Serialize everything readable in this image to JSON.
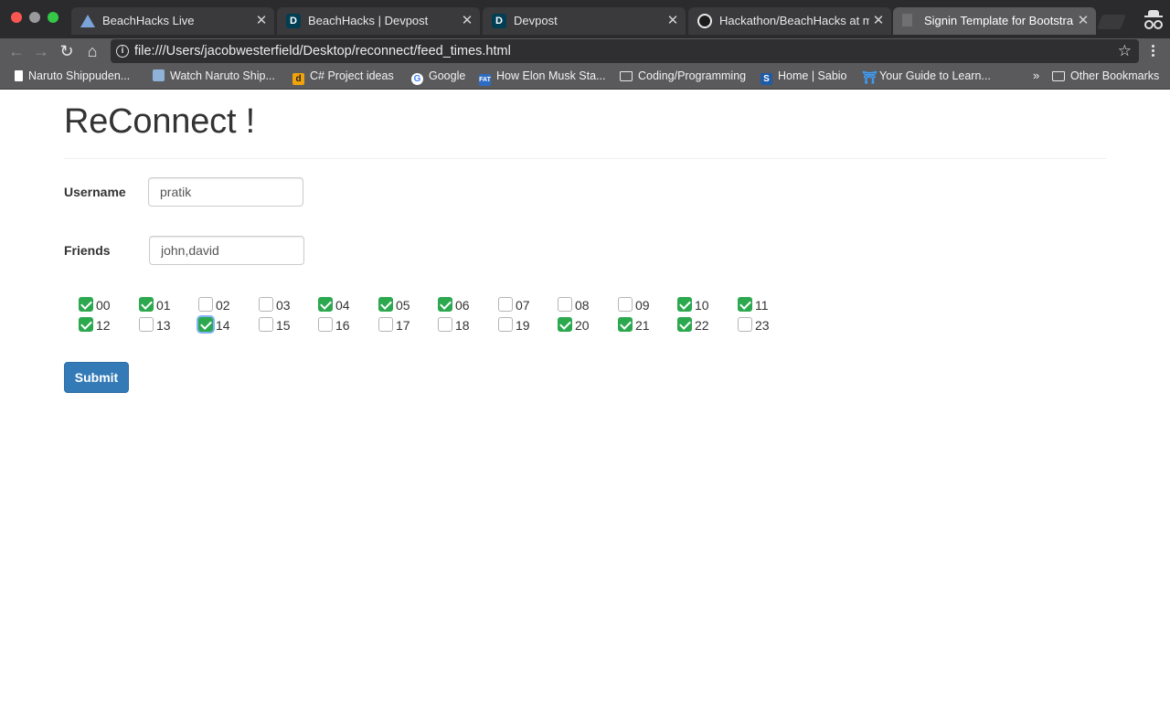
{
  "browser": {
    "tabs": [
      {
        "title": "BeachHacks Live",
        "icon": "pyramid-icon"
      },
      {
        "title": "BeachHacks | Devpost",
        "icon": "devpost-icon"
      },
      {
        "title": "Devpost",
        "icon": "devpost-icon"
      },
      {
        "title": "Hackathon/BeachHacks at ma",
        "icon": "github-icon"
      },
      {
        "title": "Signin Template for Bootstrap",
        "icon": "blank-page-icon",
        "active": true
      }
    ],
    "url": "file:///Users/jacobwesterfield/Desktop/reconnect/feed_times.html",
    "bookmarks": [
      {
        "label": "Naruto Shippuden...",
        "icon": "page-icon"
      },
      {
        "label": "Watch Naruto Ship...",
        "icon": "watch-icon"
      },
      {
        "label": "C# Project ideas",
        "icon": "d-icon"
      },
      {
        "label": "Google",
        "icon": "google-icon"
      },
      {
        "label": "How Elon Musk Sta...",
        "icon": "fat-icon"
      },
      {
        "label": "Coding/Programming",
        "icon": "folder-icon"
      },
      {
        "label": "Home | Sabio",
        "icon": "sabio-icon"
      },
      {
        "label": "Your Guide to Learn...",
        "icon": "torii-icon"
      }
    ],
    "more_bookmarks": "»",
    "other_bookmarks": "Other Bookmarks"
  },
  "page": {
    "title": "ReConnect !",
    "username_label": "Username",
    "username_value": "pratik",
    "friends_label": "Friends",
    "friends_value": "john,david",
    "hours": [
      {
        "label": "00",
        "checked": true
      },
      {
        "label": "01",
        "checked": true
      },
      {
        "label": "02",
        "checked": false
      },
      {
        "label": "03",
        "checked": false
      },
      {
        "label": "04",
        "checked": true
      },
      {
        "label": "05",
        "checked": true
      },
      {
        "label": "06",
        "checked": true
      },
      {
        "label": "07",
        "checked": false
      },
      {
        "label": "08",
        "checked": false
      },
      {
        "label": "09",
        "checked": false
      },
      {
        "label": "10",
        "checked": true
      },
      {
        "label": "11",
        "checked": true
      },
      {
        "label": "12",
        "checked": true
      },
      {
        "label": "13",
        "checked": false
      },
      {
        "label": "14",
        "checked": true,
        "focused": true
      },
      {
        "label": "15",
        "checked": false
      },
      {
        "label": "16",
        "checked": false
      },
      {
        "label": "17",
        "checked": false
      },
      {
        "label": "18",
        "checked": false
      },
      {
        "label": "19",
        "checked": false
      },
      {
        "label": "20",
        "checked": true
      },
      {
        "label": "21",
        "checked": true
      },
      {
        "label": "22",
        "checked": true
      },
      {
        "label": "23",
        "checked": false
      }
    ],
    "submit_label": "Submit"
  },
  "colors": {
    "checkbox_checked": "#2ca84f",
    "submit_button": "#337ab7",
    "chrome_dark": "#2b2b2d",
    "chrome_toolbar": "#5a5a5c"
  }
}
